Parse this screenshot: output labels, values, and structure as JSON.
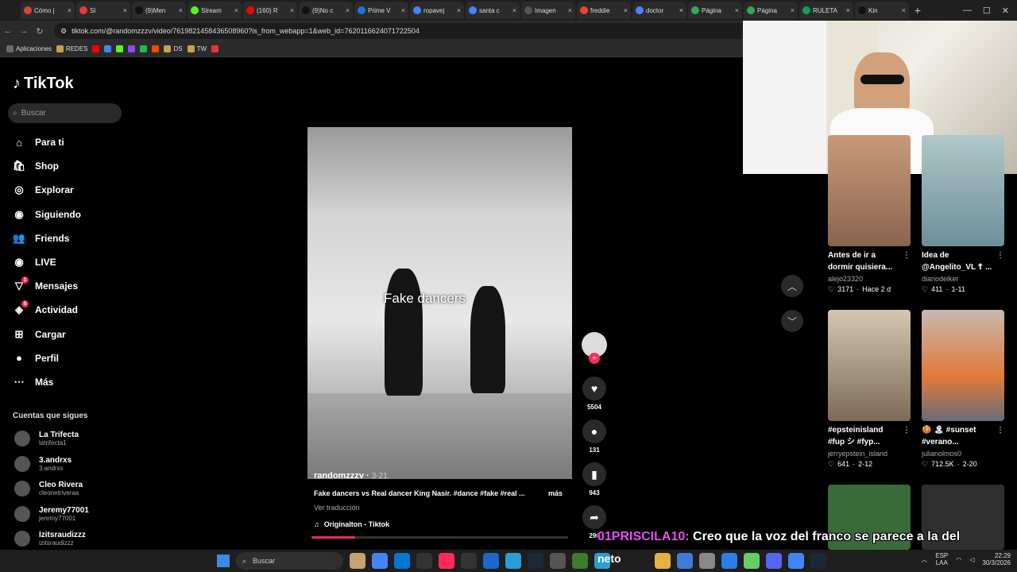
{
  "browser": {
    "tabs": [
      "Cómo j",
      "Sl",
      "(9)Men",
      "Stream",
      "(160) R",
      "(9)No c",
      "Prime V",
      "ropavej",
      "santa c",
      "Imagen",
      "freddie",
      "doctor",
      "Página",
      "Página",
      "RULETA",
      "Kin"
    ],
    "url": "tiktok.com/@randomzzzv/video/7619821458436508960?is_from_webapp=1&web_id=7620116624071722504",
    "bookmarks": [
      "Aplicaciones",
      "REDES",
      "DS",
      "TW"
    ]
  },
  "sidebar": {
    "logo": "TikTok",
    "search_placeholder": "Buscar",
    "nav": [
      {
        "label": "Para ti"
      },
      {
        "label": "Shop"
      },
      {
        "label": "Explorar"
      },
      {
        "label": "Siguiendo"
      },
      {
        "label": "Friends"
      },
      {
        "label": "LIVE"
      },
      {
        "label": "Mensajes",
        "badge": "1"
      },
      {
        "label": "Actividad",
        "badge": "8"
      },
      {
        "label": "Cargar"
      },
      {
        "label": "Perfil"
      },
      {
        "label": "Más"
      }
    ],
    "follows_header": "Cuentas que sigues",
    "follows": [
      {
        "name": "La Trifecta",
        "handle": "latrifecta1"
      },
      {
        "name": "3.andrxs",
        "handle": "3.andrxs"
      },
      {
        "name": "Cleo Rivera",
        "handle": "cleonetriveraa"
      },
      {
        "name": "Jeremy77001",
        "handle": "jeremy77001"
      },
      {
        "name": "Izitsraudizzz",
        "handle": "izitsraudizzz"
      }
    ]
  },
  "video": {
    "caption": "Fake dancers",
    "author": "randomzzzv",
    "date": "3-21",
    "description": "Fake dancers vs Real dancer King Nasir. #dance #fake #real ...",
    "more": "más",
    "translate": "Ver traducción",
    "music": "Originalton - Tiktok",
    "progress": 0.17
  },
  "actions": {
    "likes": "5504",
    "comments": "131",
    "saves": "943",
    "shares": "296"
  },
  "recommended": [
    {
      "title1": "Antes de ir a",
      "title2": "dormir quisiera...",
      "user": "alejo23320",
      "likes": "3171",
      "time": "Hace 2 d"
    },
    {
      "title1": "Idea de",
      "title2": "@Angelito_VL ☦ ...",
      "user": "diariodelker",
      "likes": "411",
      "time": "1-11"
    },
    {
      "title1": "#epsteinisland",
      "title2": "#fup シ #fyp...",
      "user": "jerryepstein_island",
      "likes": "641",
      "time": "2-12"
    },
    {
      "title1": "🍪 🏝 #sunset",
      "title2": "#verano...",
      "user": "julianolmos0",
      "likes": "712.5K",
      "time": "2-20"
    }
  ],
  "chat": {
    "user": "01PRISCILA10:",
    "message": "Creo que la voz del franco se parece a la del"
  },
  "taskbar": {
    "search": "Buscar",
    "neto": "neto",
    "lang": "ESP",
    "region": "LAA",
    "time": "22:29",
    "date": "30/3/2026"
  },
  "colors": {
    "accent": "#fe2c55",
    "chat_user": "#e94cf0"
  }
}
